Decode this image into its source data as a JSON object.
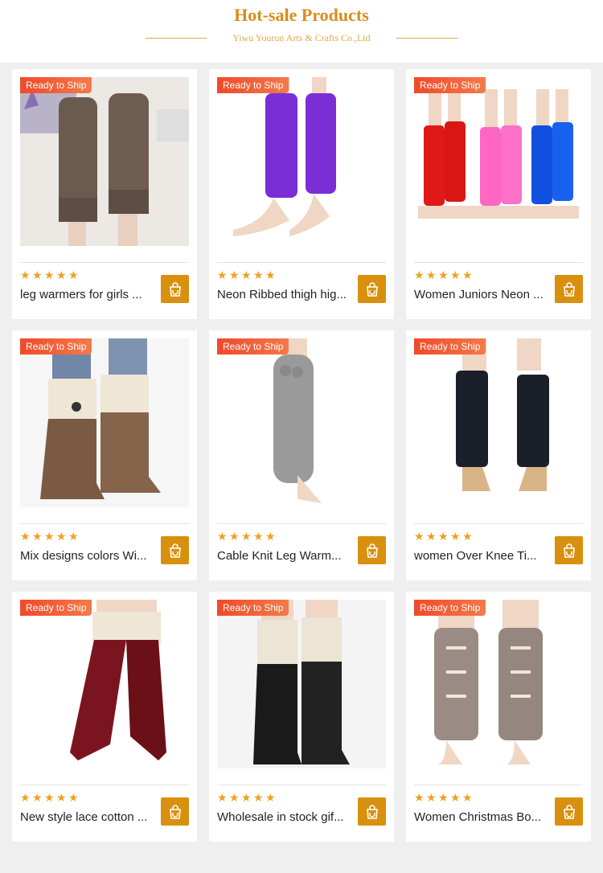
{
  "header": {
    "title": "Hot-sale Products",
    "subtitle": "Yiwu Yourun Arts & Crafts Co.,Ltd"
  },
  "colors": {
    "accent": "#d9900f",
    "badge": "#f04a2a",
    "star": "#f0a020"
  },
  "products": [
    {
      "badge": "Ready to Ship",
      "name": "leg warmers for girls ...",
      "rating": 5,
      "image": "brown cable knit leg warmers",
      "color": "#6b5a4e",
      "icon": "shopping-bag-icon"
    },
    {
      "badge": "Ready to Ship",
      "name": "Neon Ribbed thigh hig...",
      "rating": 5,
      "image": "purple ribbed leg warmers",
      "color": "#7b2ed6",
      "icon": "shopping-bag-icon"
    },
    {
      "badge": "Ready to Ship",
      "name": "Women Juniors Neon ...",
      "rating": 5,
      "image": "red pink blue neon leg warmers",
      "color": "#e01818",
      "icon": "shopping-bag-icon"
    },
    {
      "badge": "Ready to Ship",
      "name": "Mix designs colors Wi...",
      "rating": 5,
      "image": "boot cuffs with buttons",
      "color": "#efe6d6",
      "icon": "shopping-bag-icon"
    },
    {
      "badge": "Ready to Ship",
      "name": "Cable Knit Leg Warm...",
      "rating": 5,
      "image": "grey cable knit leg warmer",
      "color": "#9a9a9a",
      "icon": "shopping-bag-icon"
    },
    {
      "badge": "Ready to Ship",
      "name": "women Over Knee Ti...",
      "rating": 5,
      "image": "black stirrup leg warmers",
      "color": "#1a1f2a",
      "icon": "shopping-bag-icon"
    },
    {
      "badge": "Ready to Ship",
      "name": "New style lace cotton ...",
      "rating": 5,
      "image": "burgundy lace thigh socks",
      "color": "#7a1520",
      "icon": "shopping-bag-icon"
    },
    {
      "badge": "Ready to Ship",
      "name": "Wholesale in stock gif...",
      "rating": 5,
      "image": "cream boot cuffs with black boots",
      "color": "#ece4d4",
      "icon": "shopping-bag-icon"
    },
    {
      "badge": "Ready to Ship",
      "name": "Women Christmas Bo...",
      "rating": 5,
      "image": "christmas reindeer leg warmers",
      "color": "#9a8c84",
      "icon": "shopping-bag-icon"
    }
  ]
}
